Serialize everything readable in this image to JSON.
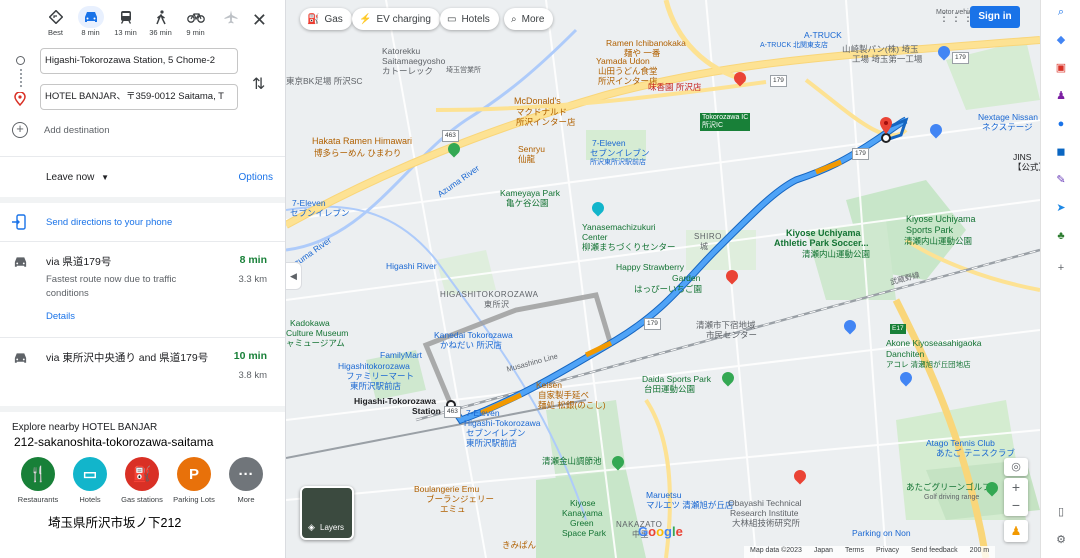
{
  "modes": [
    {
      "label": "Best",
      "icon": "diamond-route-icon"
    },
    {
      "label": "8 min",
      "icon": "car-icon",
      "active": true
    },
    {
      "label": "13 min",
      "icon": "train-icon"
    },
    {
      "label": "36 min",
      "icon": "walk-icon"
    },
    {
      "label": "9 min",
      "icon": "bike-icon"
    },
    {
      "label": "",
      "icon": "plane-icon"
    }
  ],
  "origin_value": "Higashi-Tokorozawa Station, 5 Chome-2",
  "destination_value": "HOTEL BANJAR、〒359-0012 Saitama, T",
  "add_destination": "Add destination",
  "leave_now": "Leave now",
  "options": "Options",
  "send_directions": "Send directions to your phone",
  "routes": [
    {
      "via": "via 県道179号",
      "time": "8 min",
      "distance": "3.3 km",
      "desc": "Fastest route now due to traffic conditions",
      "details": "Details"
    },
    {
      "via": "via 東所沢中央通り and 県道179号",
      "time": "10 min",
      "distance": "3.8 km"
    }
  ],
  "explore": {
    "title": "Explore nearby HOTEL BANJAR",
    "subtitle": "212-sakanoshita-tokorozawa-saitama",
    "categories": [
      {
        "label": "Restaurants",
        "color": "#188038",
        "glyph": "🍴"
      },
      {
        "label": "Hotels",
        "color": "#12b5cb",
        "glyph": "▭"
      },
      {
        "label": "Gas stations",
        "color": "#d93025",
        "glyph": "⛽"
      },
      {
        "label": "Parking Lots",
        "color": "#e8710a",
        "glyph": "P"
      },
      {
        "label": "More",
        "color": "#70757a",
        "glyph": "···"
      }
    ],
    "address_jp": "埼玉県所沢市坂ノ下212"
  },
  "map": {
    "chips": [
      "Gas",
      "EV charging",
      "Hotels",
      "More"
    ],
    "sign_in": "Sign in",
    "layers": "Layers",
    "attribution": [
      "Map data ©2023",
      "Japan",
      "Terms",
      "Privacy",
      "Send feedback",
      "200 m"
    ],
    "google": "Google",
    "labels": {
      "a_truck": "A-TRUCK",
      "a_truck_jp": "A-TRUCK 北関東支店",
      "yamazaki": "山崎製パン(株) 埼玉",
      "yamazaki2": "工場 埼玉第一工場",
      "katorekku": "Katorekku",
      "katorekku2": "Saitamaegyosho",
      "katorekku3": "カトーレック",
      "katorekku4": "埼玉営業所",
      "tokyobk": "東京BK足場 所沢SC",
      "yamada": "Yamada Udon",
      "yamada2": "山田うどん食堂",
      "yamada3": "所沢インター店",
      "ramen_ichi": "Ramen Ichibanokaka",
      "ramen_ichi2": "麺や 一番",
      "mikado": "味香園 所沢店",
      "mcd": "McDonald's",
      "mcd2": "マクドナルド",
      "mcd3": "所沢インター店",
      "nextage": "Nextage Nissan",
      "nextage2": "ネクステージ",
      "jins": "JINS",
      "jins2": "【公式】",
      "hakata": "Hakata Ramen Himawari",
      "hakata2": "博多らーめん ひまわり",
      "senryu": "Senryu",
      "senryu2": "仙龍",
      "seven1": "7-Eleven",
      "seven1b": "セブンイレブン",
      "seven1c": "所沢東所沢駅前店",
      "tokorozawa_ic": "Tokorozawa IC",
      "tokorozawa_ic2": "所沢IC",
      "seven_left": "7-Eleven",
      "seven_left2": "セブンイレブン",
      "kameyaya": "Kameyaya Park",
      "kameyaya2": "亀ケ谷公園",
      "yanase": "Yanasemachizukuri",
      "yanase2": "Center",
      "yanase3": "柳瀬まちづくりセンター",
      "kiyose_ath": "Kiyose Uchiyama",
      "kiyose_ath2": "Athletic Park Soccer...",
      "kiyose_ath3": "清瀬内山運動公園",
      "kiyose_sports": "Kiyose Uchiyama",
      "kiyose_sports2": "Sports Park",
      "kiyose_sports3": "清瀬内山運動公園",
      "shiro": "SHIRO",
      "shiro2": "城",
      "happy": "Happy Strawberry",
      "happy2": "Garden",
      "happy3": "はっぴーいちご園",
      "higashi_river": "Higashi River",
      "azuma": "Azuma River",
      "higashitokorozawa": "HIGASHITOKOROZAWA",
      "higashitokorozawa2": "東所沢",
      "kadokawa": "Kadokawa",
      "kadokawa2": "Culture Museum",
      "kadokawa3": "ャミュージアム",
      "kanedai": "Kanedai Tokorozawa",
      "kanedai2": "かねだい 所沢店",
      "familymart": "FamilyMart",
      "familymart2": "Higashitokorozawa",
      "familymart3": "ファミリーマート",
      "familymart4": "東所沢駅前店",
      "musashino": "Musashino Line",
      "kiyose_shimin": "清瀬市下宿地域",
      "kiyose_shimin2": "市民センター",
      "akone": "Akone Kiyoseasahigaoka",
      "akone2": "Danchiten",
      "akone3": "アコレ 清瀬旭が丘団地店",
      "daida": "Daida Sports Park",
      "daida2": "台田運動公園",
      "keisen": "Keisen",
      "keisen2": "自家製手延べ",
      "keisen3": "麺処 松銀(のこし)",
      "station": "Higashi-Tokorozawa",
      "station2": "Station",
      "seven_st": "7-Eleven",
      "seven_st2": "Higashi-Tokorozawa",
      "seven_st3": "セブンイレブン",
      "seven_st4": "東所沢駅前店",
      "kiyose_kanayama": "清瀬金山調節池",
      "boulangerie": "Boulangerie Emu",
      "boulangerie2": "ブーランジェリー",
      "boulangerie3": "エミュ",
      "maruetsu": "Maruetsu",
      "maruetsu2": "マルエツ 清瀬旭が丘店",
      "obayashi": "Obayashi Technical",
      "obayashi2": "Research Institute",
      "obayashi3": "大林組技術研究所",
      "kiyose_green": "Kiyose",
      "kiyose_green2": "Kanayama",
      "kiyose_green3": "Green",
      "kiyose_green4": "Space Park",
      "nakazato": "NAKAZATO",
      "nakazato2": "中里",
      "parking": "Parking on Non",
      "atago": "Atago Tennis Club",
      "atago2": "あたご テニスクラブ",
      "atago_golf": "あたごグリーンゴルフ",
      "atago_golf2": "Golf driving range",
      "kimuraya": "きみぱん",
      "shinkansen": "武蔵野線",
      "motorvehicle": "Motor vehicle dealer",
      "ramen_r": "ラーメン"
    },
    "roads": [
      "179",
      "463",
      "179",
      "463",
      "179",
      "179",
      "E17"
    ]
  }
}
